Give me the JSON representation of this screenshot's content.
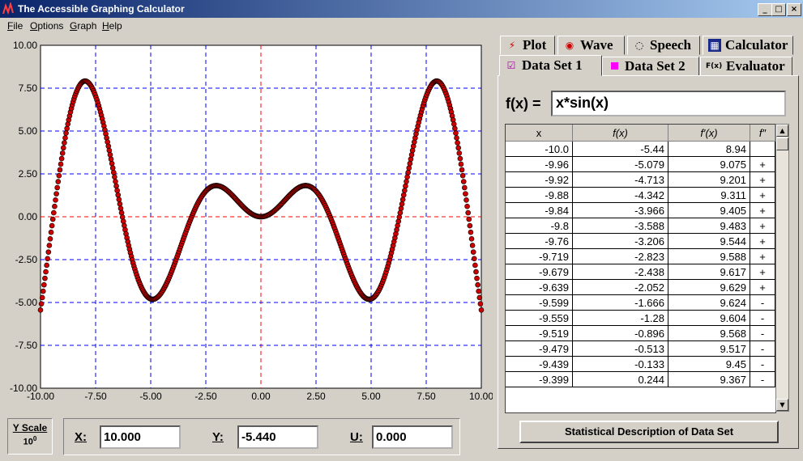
{
  "window": {
    "title": "The Accessible Graphing Calculator",
    "controls": {
      "minimize": "_",
      "maximize": "□",
      "close": "×"
    }
  },
  "menu": [
    "File",
    "Options",
    "Graph",
    "Help"
  ],
  "plot": {
    "y_ticks": [
      "10.00",
      "7.50",
      "5.00",
      "2.50",
      "0.00",
      "-2.50",
      "-5.00",
      "-7.50",
      "-10.00"
    ],
    "x_ticks": [
      "-10.00",
      "-7.50",
      "-5.00",
      "-2.50",
      "0.00",
      "2.50",
      "5.00",
      "7.50",
      "10.00"
    ],
    "colors": {
      "background": "#ffffff",
      "grid": "#0000ff",
      "axis": "#ff0000",
      "point": "#cc0000",
      "point_outline": "#000000"
    }
  },
  "chart_data": {
    "type": "scatter",
    "function": "x*sin(x)",
    "xlim": [
      -10,
      10
    ],
    "ylim": [
      -10,
      10
    ],
    "grid": true,
    "x_start": -10,
    "x_end": 10,
    "x_step": 0.04
  },
  "tabs": {
    "row1": [
      {
        "label": "Plot",
        "icon": "plot-icon"
      },
      {
        "label": "Wave",
        "icon": "wave-icon"
      },
      {
        "label": "Speech",
        "icon": "ear-icon"
      },
      {
        "label": "Calculator",
        "icon": "calculator-icon"
      }
    ],
    "row2": [
      {
        "label": "Data Set 1",
        "icon": "checkbox-checked-icon"
      },
      {
        "label": "Data Set 2",
        "icon": "magenta-square-icon"
      },
      {
        "label": "Evaluator",
        "icon": "fx-icon",
        "icon_text": "F(x)"
      }
    ]
  },
  "function": {
    "label": "f(x) =",
    "value": "x*sin(x)"
  },
  "table": {
    "headers": [
      "x",
      "f(x)",
      "f′(x)",
      "f″"
    ],
    "rows": [
      [
        "-10.0",
        "-5.44",
        "8.94",
        ""
      ],
      [
        "-9.96",
        "-5.079",
        "9.075",
        "+"
      ],
      [
        "-9.92",
        "-4.713",
        "9.201",
        "+"
      ],
      [
        "-9.88",
        "-4.342",
        "9.311",
        "+"
      ],
      [
        "-9.84",
        "-3.966",
        "9.405",
        "+"
      ],
      [
        "-9.8",
        "-3.588",
        "9.483",
        "+"
      ],
      [
        "-9.76",
        "-3.206",
        "9.544",
        "+"
      ],
      [
        "-9.719",
        "-2.823",
        "9.588",
        "+"
      ],
      [
        "-9.679",
        "-2.438",
        "9.617",
        "+"
      ],
      [
        "-9.639",
        "-2.052",
        "9.629",
        "+"
      ],
      [
        "-9.599",
        "-1.666",
        "9.624",
        "-"
      ],
      [
        "-9.559",
        "-1.28",
        "9.604",
        "-"
      ],
      [
        "-9.519",
        "-0.896",
        "9.568",
        "-"
      ],
      [
        "-9.479",
        "-0.513",
        "9.517",
        "-"
      ],
      [
        "-9.439",
        "-0.133",
        "9.45",
        "-"
      ],
      [
        "-9.399",
        "0.244",
        "9.367",
        "-"
      ]
    ]
  },
  "stat_button": "Statistical Description of Data Set",
  "y_scale": {
    "label": "Y Scale",
    "value": "10",
    "exponent": "0"
  },
  "coords": [
    {
      "label": "X:",
      "value": "10.000"
    },
    {
      "label": "Y:",
      "value": "-5.440"
    },
    {
      "label": "U:",
      "value": "0.000"
    }
  ]
}
